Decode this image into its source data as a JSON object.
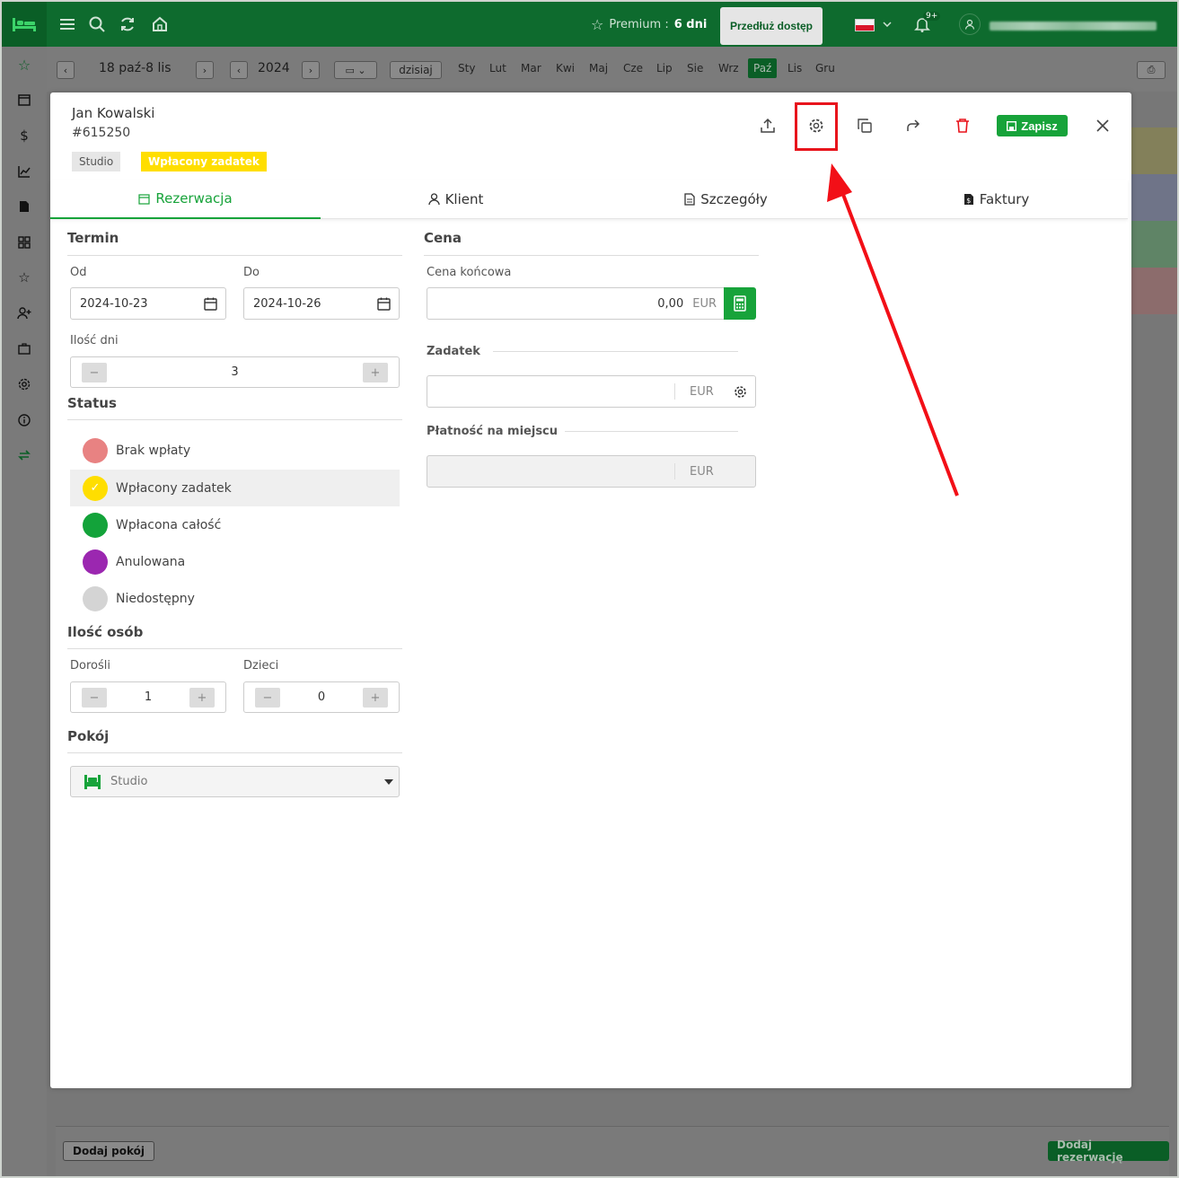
{
  "topbar": {
    "premium_label": "Premium :",
    "premium_value": "6 dni",
    "extend_label": "Przedłuż dostęp",
    "notifications_badge": "9+"
  },
  "calendar": {
    "range": "18 paź-8 lis",
    "year": "2024",
    "today_label": "dzisiaj",
    "months": [
      "Sty",
      "Lut",
      "Mar",
      "Kwi",
      "Maj",
      "Cze",
      "Lip",
      "Sie",
      "Wrz",
      "Paź",
      "Lis",
      "Gru"
    ],
    "active_month": "Paź"
  },
  "bottom": {
    "add_room_label": "Dodaj pokój",
    "add_reservation_label": "Dodaj rezerwację"
  },
  "modal": {
    "guest_name": "Jan Kowalski",
    "reservation_id": "#615250",
    "room_tag": "Studio",
    "status_tag": "Wpłacony zadatek",
    "save_label": "Zapisz",
    "tabs": [
      {
        "label": "Rezerwacja",
        "icon": "calendar-icon",
        "active": true
      },
      {
        "label": "Klient",
        "icon": "user-icon",
        "active": false
      },
      {
        "label": "Szczegóły",
        "icon": "document-icon",
        "active": false
      },
      {
        "label": "Faktury",
        "icon": "invoice-icon",
        "active": false
      }
    ]
  },
  "term": {
    "title": "Termin",
    "from_label": "Od",
    "from_value": "2024-10-23",
    "to_label": "Do",
    "to_value": "2024-10-26",
    "days_label": "Ilość dni",
    "days_value": "3"
  },
  "status": {
    "title": "Status",
    "options": [
      {
        "label": "Brak wpłaty",
        "color": "#e88282"
      },
      {
        "label": "Wpłacony zadatek",
        "color": "#ffde00",
        "selected": true
      },
      {
        "label": "Wpłacona całość",
        "color": "#13a33a"
      },
      {
        "label": "Anulowana",
        "color": "#9b27b0"
      },
      {
        "label": "Niedostępny",
        "color": "#d4d4d4"
      }
    ]
  },
  "people": {
    "title": "Ilość osób",
    "adults_label": "Dorośli",
    "adults_value": "1",
    "children_label": "Dzieci",
    "children_value": "0"
  },
  "room": {
    "title": "Pokój",
    "selected": "Studio"
  },
  "price": {
    "title": "Cena",
    "final_label": "Cena końcowa",
    "final_value": "0,00",
    "currency": "EUR",
    "deposit_label": "Zadatek",
    "onsite_label": "Płatność na miejscu"
  },
  "colors": {
    "brand_green": "#17a33a",
    "topbar_green": "#0e6b2e",
    "highlight_red": "#e8141c"
  }
}
